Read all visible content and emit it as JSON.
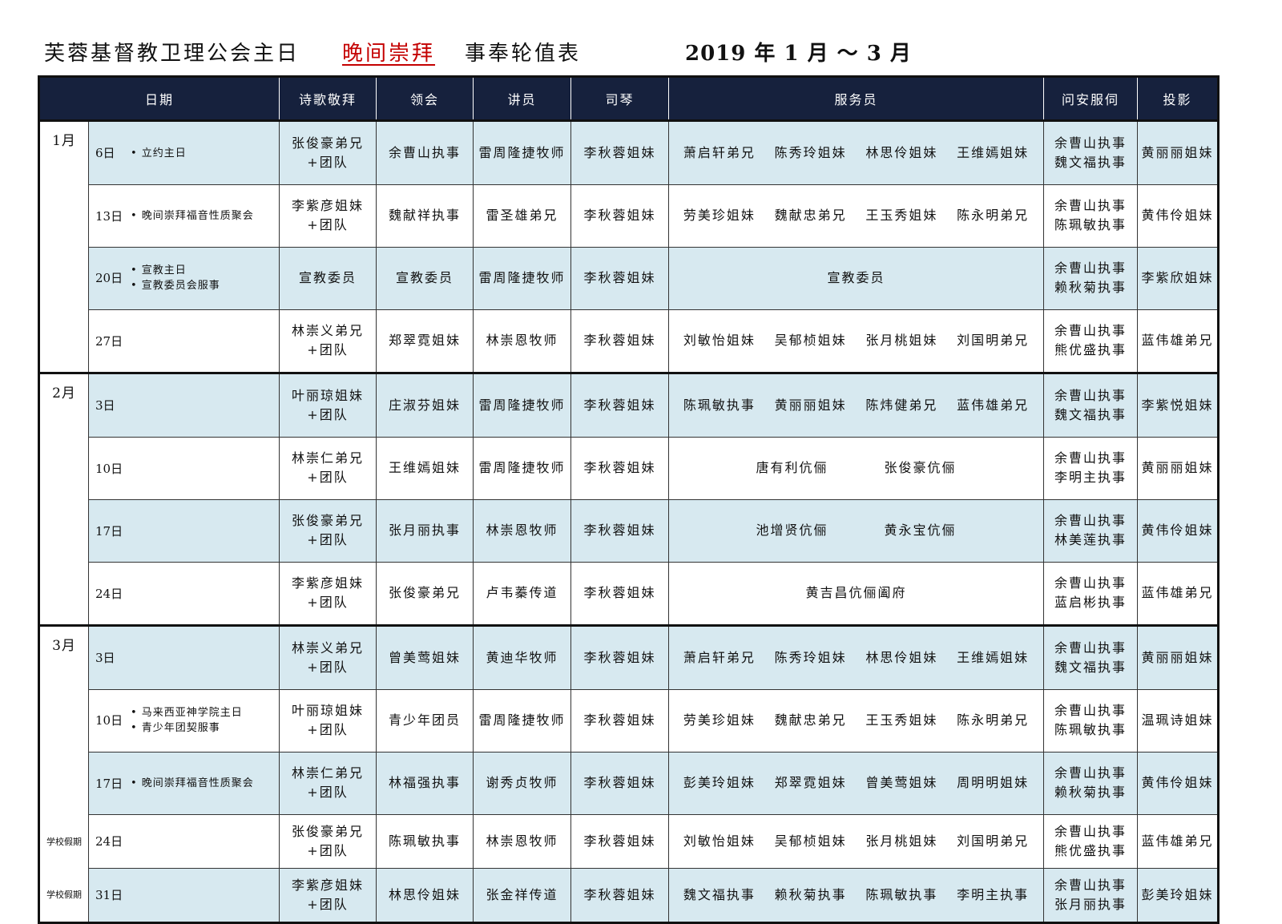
{
  "title": {
    "part1": "芙蓉基督教卫理公会主日",
    "part2": "晚间崇拜",
    "part3": "事奉轮值表",
    "part4": "2019 年 1 月 ～ 3 月"
  },
  "headers": [
    "日期",
    "诗歌敬拜",
    "领会",
    "讲员",
    "司琴",
    "服务员",
    "问安服伺",
    "投影"
  ],
  "months": [
    {
      "month": "1月",
      "rows": [
        {
          "day": "6日",
          "notes": [
            "• 立约主日"
          ],
          "worship": [
            "张俊豪弟兄",
            "+团队"
          ],
          "lead": "余曹山执事",
          "speaker": "雷周隆捷牧师",
          "piano": "李秋蓉姐妹",
          "servers": [
            "萧启轩弟兄",
            "陈秀玲姐妹",
            "林思伶姐妹",
            "王维嫣姐妹"
          ],
          "greeters": [
            "余曹山执事",
            "魏文福执事"
          ],
          "projection": "黄丽丽姐妹"
        },
        {
          "day": "13日",
          "notes": [
            "• 晚间崇拜福音性质聚会"
          ],
          "worship": [
            "李紫彦姐妹",
            "+团队"
          ],
          "lead": "魏献祥执事",
          "speaker": "雷圣雄弟兄",
          "piano": "李秋蓉姐妹",
          "servers": [
            "劳美珍姐妹",
            "魏献忠弟兄",
            "王玉秀姐妹",
            "陈永明弟兄"
          ],
          "greeters": [
            "余曹山执事",
            "陈珮敏执事"
          ],
          "projection": "黄伟伶姐妹"
        },
        {
          "day": "20日",
          "notes": [
            "• 宣教主日",
            "• 宣教委员会服事"
          ],
          "worship": [
            "宣教委员"
          ],
          "lead": "宣教委员",
          "speaker": "雷周隆捷牧师",
          "piano": "李秋蓉姐妹",
          "servers": [
            "宣教委员"
          ],
          "greeters": [
            "余曹山执事",
            "赖秋菊执事"
          ],
          "projection": "李紫欣姐妹"
        },
        {
          "day": "27日",
          "notes": [],
          "worship": [
            "林崇义弟兄",
            "+团队"
          ],
          "lead": "郑翠霓姐妹",
          "speaker": "林崇恩牧师",
          "piano": "李秋蓉姐妹",
          "servers": [
            "刘敏怡姐妹",
            "吴郁桢姐妹",
            "张月桃姐妹",
            "刘国明弟兄"
          ],
          "greeters": [
            "余曹山执事",
            "熊优盛执事"
          ],
          "projection": "蓝伟雄弟兄"
        }
      ]
    },
    {
      "month": "2月",
      "rows": [
        {
          "day": "3日",
          "notes": [],
          "worship": [
            "叶丽琼姐妹",
            "+团队"
          ],
          "lead": "庄淑芬姐妹",
          "speaker": "雷周隆捷牧师",
          "piano": "李秋蓉姐妹",
          "servers": [
            "陈珮敏执事",
            "黄丽丽姐妹",
            "陈炜健弟兄",
            "蓝伟雄弟兄"
          ],
          "greeters": [
            "余曹山执事",
            "魏文福执事"
          ],
          "projection": "李紫悦姐妹"
        },
        {
          "day": "10日",
          "notes": [],
          "worship": [
            "林崇仁弟兄",
            "+团队"
          ],
          "lead": "王维嫣姐妹",
          "speaker": "雷周隆捷牧师",
          "piano": "李秋蓉姐妹",
          "servers": [
            "唐有利伉俪",
            "张俊豪伉俪"
          ],
          "greeters": [
            "余曹山执事",
            "李明主执事"
          ],
          "projection": "黄丽丽姐妹"
        },
        {
          "day": "17日",
          "notes": [],
          "worship": [
            "张俊豪弟兄",
            "+团队"
          ],
          "lead": "张月丽执事",
          "speaker": "林崇恩牧师",
          "piano": "李秋蓉姐妹",
          "servers": [
            "池增贤伉俪",
            "黄永宝伉俪"
          ],
          "greeters": [
            "余曹山执事",
            "林美莲执事"
          ],
          "projection": "黄伟伶姐妹"
        },
        {
          "day": "24日",
          "notes": [],
          "worship": [
            "李紫彦姐妹",
            "+团队"
          ],
          "lead": "张俊豪弟兄",
          "speaker": "卢韦蓁传道",
          "piano": "李秋蓉姐妹",
          "servers": [
            "黄吉昌伉俪阖府"
          ],
          "greeters": [
            "余曹山执事",
            "蓝启彬执事"
          ],
          "projection": "蓝伟雄弟兄"
        }
      ]
    },
    {
      "month": "3月",
      "rows": [
        {
          "day": "3日",
          "notes": [],
          "worship": [
            "林崇义弟兄",
            "+团队"
          ],
          "lead": "曾美莺姐妹",
          "speaker": "黄迪华牧师",
          "piano": "李秋蓉姐妹",
          "servers": [
            "萧启轩弟兄",
            "陈秀玲姐妹",
            "林思伶姐妹",
            "王维嫣姐妹"
          ],
          "greeters": [
            "余曹山执事",
            "魏文福执事"
          ],
          "projection": "黄丽丽姐妹"
        },
        {
          "day": "10日",
          "notes": [
            "• 马来西亚神学院主日",
            "• 青少年团契服事"
          ],
          "worship": [
            "叶丽琼姐妹",
            "+团队"
          ],
          "lead": "青少年团员",
          "speaker": "雷周隆捷牧师",
          "piano": "李秋蓉姐妹",
          "servers": [
            "劳美珍姐妹",
            "魏献忠弟兄",
            "王玉秀姐妹",
            "陈永明弟兄"
          ],
          "greeters": [
            "余曹山执事",
            "陈珮敏执事"
          ],
          "projection": "温珮诗姐妹"
        },
        {
          "day": "17日",
          "notes": [
            "• 晚间崇拜福音性质聚会"
          ],
          "worship": [
            "林崇仁弟兄",
            "+团队"
          ],
          "lead": "林福强执事",
          "speaker": "谢秀贞牧师",
          "piano": "李秋蓉姐妹",
          "servers": [
            "彭美玲姐妹",
            "郑翠霓姐妹",
            "曾美莺姐妹",
            "周明明姐妹"
          ],
          "greeters": [
            "余曹山执事",
            "赖秋菊执事"
          ],
          "projection": "黄伟伶姐妹"
        },
        {
          "day": "24日",
          "notes": [],
          "holiday": "学校假期",
          "worship": [
            "张俊豪弟兄",
            "+团队"
          ],
          "lead": "陈珮敏执事",
          "speaker": "林崇恩牧师",
          "piano": "李秋蓉姐妹",
          "servers": [
            "刘敏怡姐妹",
            "吴郁桢姐妹",
            "张月桃姐妹",
            "刘国明弟兄"
          ],
          "greeters": [
            "余曹山执事",
            "熊优盛执事"
          ],
          "projection": "蓝伟雄弟兄"
        },
        {
          "day": "31日",
          "notes": [],
          "holiday": "学校假期",
          "worship": [
            "李紫彦姐妹",
            "+团队"
          ],
          "lead": "林思伶姐妹",
          "speaker": "张金祥传道",
          "piano": "李秋蓉姐妹",
          "servers": [
            "魏文福执事",
            "赖秋菊执事",
            "陈珮敏执事",
            "李明主执事"
          ],
          "greeters": [
            "余曹山执事",
            "张月丽执事"
          ],
          "projection": "彭美玲姐妹"
        }
      ]
    }
  ]
}
